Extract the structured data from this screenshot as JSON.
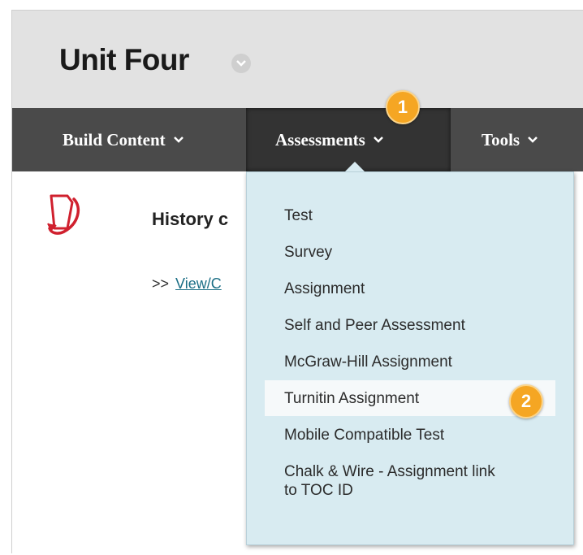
{
  "page": {
    "title": "Unit Four"
  },
  "nav": {
    "build_content": "Build Content",
    "assessments": "Assessments",
    "tools": "Tools"
  },
  "badges": {
    "step1": "1",
    "step2": "2"
  },
  "content_item": {
    "title": "History c",
    "link_prefix": ">>",
    "link_text": "View/C"
  },
  "menu": {
    "items": [
      "Test",
      "Survey",
      "Assignment",
      "Self and Peer Assessment",
      "McGraw-Hill Assignment",
      "Turnitin Assignment",
      "Mobile Compatible Test",
      "Chalk & Wire - Assignment link",
      "to TOC ID"
    ]
  },
  "colors": {
    "header_bg": "#e2e2e2",
    "navbar_bg": "#4a4a4a",
    "menu_bg": "#d8ebf1",
    "badge": "#f5a623",
    "link": "#1a6e85",
    "icon_red": "#d0202e"
  }
}
